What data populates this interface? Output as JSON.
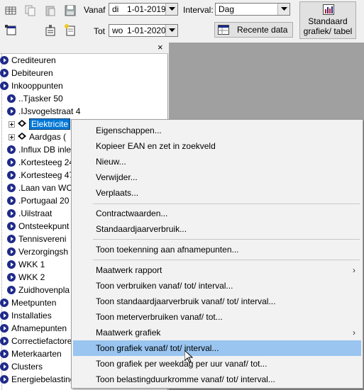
{
  "toolbar": {
    "vanaf_label": "Vanaf",
    "vanaf_day": "di",
    "vanaf_date": "1-01-2019",
    "tot_label": "Tot",
    "tot_day": "wo",
    "tot_date": "1-01-2020",
    "interval_label": "Interval:",
    "interval_value": "Dag",
    "recent_button": "Recente data",
    "standard_button_line1": "Standaard",
    "standard_button_line2": "grafiek/ tabel"
  },
  "panel": {
    "close_glyph": "×"
  },
  "tree": [
    {
      "label": "Crediteuren"
    },
    {
      "label": "Debiteuren"
    },
    {
      "label": "Inkooppunten"
    },
    {
      "label": "..Tjasker 50"
    },
    {
      "label": ".IJsvogelstraat 4"
    },
    {
      "label": "Elektricite"
    },
    {
      "label": "Aardgas ("
    },
    {
      "label": ".Influx DB inle"
    },
    {
      "label": ".Kortesteeg 24"
    },
    {
      "label": ".Kortesteeg 47"
    },
    {
      "label": ".Laan van WC"
    },
    {
      "label": ".Portugaal 20"
    },
    {
      "label": ".Uilstraat"
    },
    {
      "label": "Ontsteekpunt"
    },
    {
      "label": "Tennisvereni"
    },
    {
      "label": "Verzorgingsh"
    },
    {
      "label": "WKK 1"
    },
    {
      "label": "WKK 2"
    },
    {
      "label": "Zuidhovenpla"
    },
    {
      "label": "Meetpunten"
    },
    {
      "label": "Installaties"
    },
    {
      "label": "Afnamepunten"
    },
    {
      "label": "Correctiefactoren"
    },
    {
      "label": "Meterkaarten"
    },
    {
      "label": "Clusters"
    },
    {
      "label": "Energiebelastings"
    }
  ],
  "menu": [
    {
      "label": "Eigenschappen..."
    },
    {
      "label": "Kopieer EAN en zet in zoekveld"
    },
    {
      "label": "Nieuw..."
    },
    {
      "label": "Verwijder..."
    },
    {
      "label": "Verplaats..."
    },
    {
      "label": "Contractwaarden..."
    },
    {
      "label": "Standaardjaarverbruik..."
    },
    {
      "label": "Toon toekenning aan afnamepunten..."
    },
    {
      "label": "Maatwerk rapport",
      "submenu_glyph": "›"
    },
    {
      "label": "Toon verbruiken vanaf/ tot/ interval..."
    },
    {
      "label": "Toon standaardjaarverbruik vanaf/ tot/ interval..."
    },
    {
      "label": "Toon meterverbruiken vanaf/ tot..."
    },
    {
      "label": "Maatwerk grafiek",
      "submenu_glyph": "›"
    },
    {
      "label": "Toon grafiek vanaf/ tot/ interval..."
    },
    {
      "label": "Toon grafiek per weekdag per uur vanaf/ tot..."
    },
    {
      "label": "Toon belastingduurkromme vanaf/ tot/ interval..."
    }
  ],
  "colors": {
    "menu_highlight": "#99c5f0",
    "tree_icon": "#1f2a8a",
    "tree_selection": "#0078d7"
  }
}
